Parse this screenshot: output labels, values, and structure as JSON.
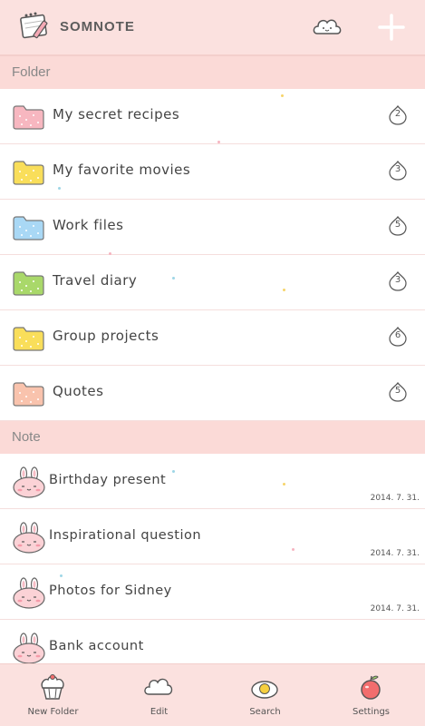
{
  "header": {
    "brand": "SOMNOTE"
  },
  "folder_section": {
    "title": "Folder",
    "items": [
      {
        "label": "My secret recipes",
        "count": "2",
        "color": "#f7b7c0"
      },
      {
        "label": "My favorite movies",
        "count": "3",
        "color": "#f9de5a"
      },
      {
        "label": "Work files",
        "count": "5",
        "color": "#a9d8f5"
      },
      {
        "label": "Travel diary",
        "count": "3",
        "color": "#a9d86a"
      },
      {
        "label": "Group projects",
        "count": "6",
        "color": "#f9de5a"
      },
      {
        "label": "Quotes",
        "count": "5",
        "color": "#f9c3ad"
      }
    ]
  },
  "note_section": {
    "title": "Note",
    "items": [
      {
        "label": "Birthday present",
        "date": "2014. 7. 31."
      },
      {
        "label": "Inspirational question",
        "date": "2014. 7. 31."
      },
      {
        "label": "Photos for Sidney",
        "date": "2014. 7. 31."
      },
      {
        "label": "Bank account",
        "date": ""
      }
    ]
  },
  "tabbar": {
    "tabs": [
      {
        "label": "New Folder",
        "icon": "cupcake-icon"
      },
      {
        "label": "Edit",
        "icon": "cloud-icon"
      },
      {
        "label": "Search",
        "icon": "egg-icon"
      },
      {
        "label": "Settings",
        "icon": "apple-icon"
      }
    ]
  },
  "colors": {
    "header_bg": "#fbe1df",
    "section_bg": "#fbdad7",
    "tabbar_bg": "#fbe1df"
  }
}
